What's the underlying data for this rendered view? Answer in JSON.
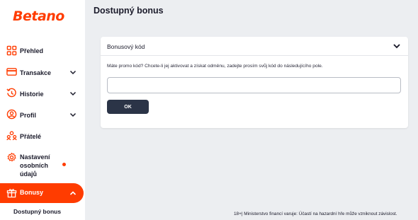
{
  "brand": {
    "logo_text": "Betano",
    "accent_color": "#ff3c00"
  },
  "sidebar": {
    "items": [
      {
        "label": "Přehled",
        "icon": "grid-icon",
        "has_chevron": false
      },
      {
        "label": "Transakce",
        "icon": "credit-card-icon",
        "has_chevron": true
      },
      {
        "label": "Historie",
        "icon": "history-icon",
        "has_chevron": true
      },
      {
        "label": "Profil",
        "icon": "user-icon",
        "has_chevron": true
      },
      {
        "label": "Přátelé",
        "icon": "friends-icon",
        "has_chevron": false
      },
      {
        "label": "Nastavení osobních údajů",
        "label_lines": [
          "Nastavení",
          "osobních",
          "údajů"
        ],
        "icon": "gear-icon",
        "has_chevron": false,
        "has_notification_dot": true
      },
      {
        "label": "Bonusy",
        "icon": "gift-icon",
        "has_chevron": true,
        "active": true
      }
    ],
    "subitem": {
      "label": "Dostupný bonus"
    }
  },
  "main": {
    "title": "Dostupný bonus",
    "card": {
      "header_title": "Bonusový kód",
      "description": "Máte promo kód? Chcete-li jej aktivovat a získat odměnu, zadejte prosím svůj kód do následujícího pole.",
      "input_value": "",
      "input_placeholder": "",
      "ok_label": "OK"
    }
  },
  "footer": {
    "text": "18+| Ministerstvo financí varuje: Účastí na hazardní hře může vzniknout závislost."
  }
}
